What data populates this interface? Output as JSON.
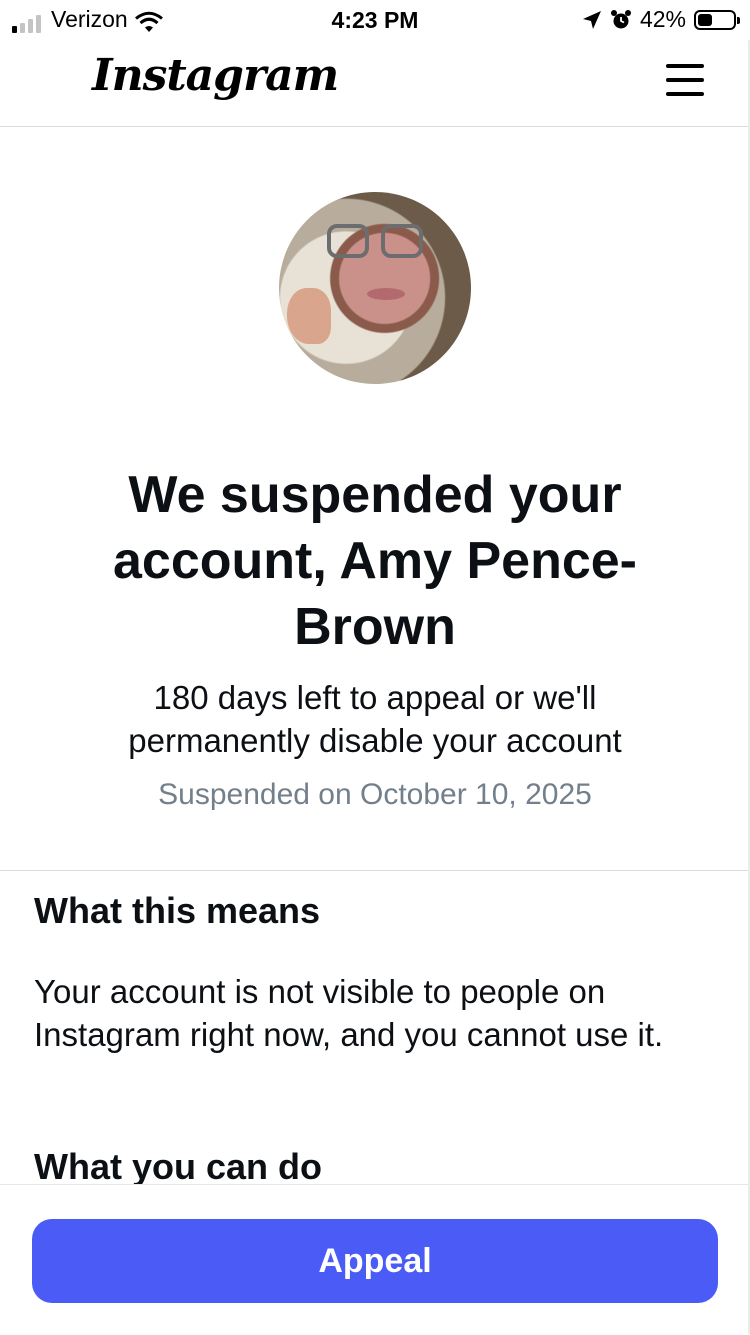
{
  "status_bar": {
    "carrier": "Verizon",
    "time": "4:23 PM",
    "battery_percent": "42%",
    "battery_level": 0.42,
    "signal_bars_active": 1,
    "signal_bars_total": 4
  },
  "header": {
    "logo_text": "Instagram",
    "menu_icon": "hamburger-menu-icon"
  },
  "profile": {
    "avatar": "profile-photo"
  },
  "notice": {
    "headline": "We suspended your account, Amy Pence-Brown",
    "subtext": "180 days left to appeal or we'll permanently disable your account",
    "date_text": "Suspended on October 10, 2025"
  },
  "sections": [
    {
      "title": "What this means",
      "body": "Your account is not visible to people on Instagram right now, and you cannot use it."
    },
    {
      "title": "What you can do"
    }
  ],
  "actions": {
    "appeal_label": "Appeal"
  },
  "colors": {
    "primary_button": "#4a5cf5",
    "secondary_text": "#737f8b",
    "text": "#0c1014",
    "divider": "#dbdbdb"
  }
}
